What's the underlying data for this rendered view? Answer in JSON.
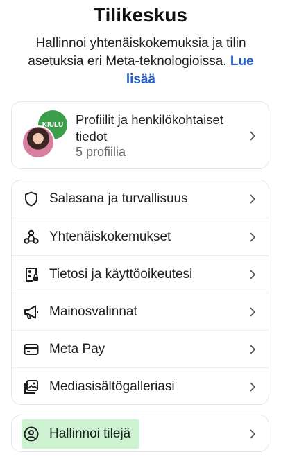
{
  "header": {
    "title": "Tilikeskus",
    "description": "Hallinnoi yhtenäiskokemuksia ja tilin asetuksia eri Meta-teknologioissa.",
    "learn_more": "Lue lisää"
  },
  "profiles": {
    "title": "Profiilit ja henkilökohtaiset tiedot",
    "count": "5 profiilia",
    "badge_text": "KIULU"
  },
  "settings": {
    "items": [
      {
        "label": "Salasana ja turvallisuus",
        "icon": "shield-icon"
      },
      {
        "label": "Yhtenäiskokemukset",
        "icon": "connected-experiences-icon"
      },
      {
        "label": "Tietosi ja käyttöoikeutesi",
        "icon": "id-lock-icon"
      },
      {
        "label": "Mainosvalinnat",
        "icon": "megaphone-icon"
      },
      {
        "label": "Meta Pay",
        "icon": "credit-card-icon"
      },
      {
        "label": "Mediasisältögalleriasi",
        "icon": "media-gallery-icon"
      }
    ]
  },
  "accounts": {
    "label": "Hallinnoi tilejä",
    "icon": "account-circle-icon",
    "highlight_color": "#a3e7aa"
  },
  "colors": {
    "link": "#1f5fc9",
    "text": "#1c1e21",
    "muted": "#65676b",
    "border": "#e3e5e8"
  }
}
